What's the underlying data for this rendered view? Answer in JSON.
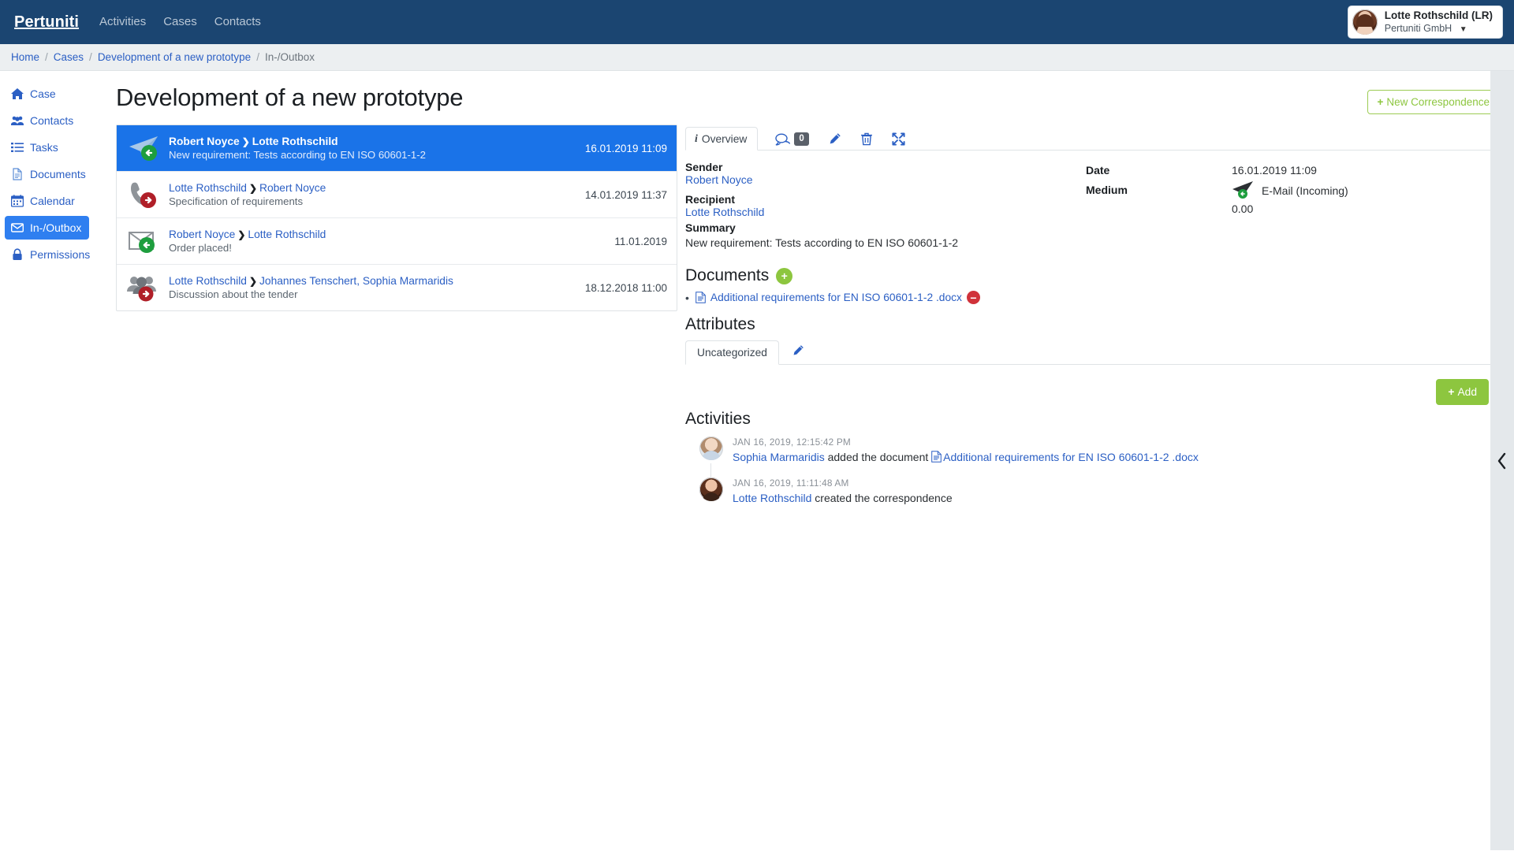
{
  "navbar": {
    "brand": "Pertuniti",
    "links": [
      "Activities",
      "Cases",
      "Contacts"
    ],
    "user": {
      "name": "Lotte Rothschild (LR)",
      "org": "Pertuniti GmbH"
    }
  },
  "breadcrumb": {
    "items": [
      {
        "label": "Home",
        "current": false
      },
      {
        "label": "Cases",
        "current": false
      },
      {
        "label": "Development of a new prototype",
        "current": false
      },
      {
        "label": "In-/Outbox",
        "current": true
      }
    ],
    "separator": "/"
  },
  "sidebar": {
    "items": [
      {
        "label": "Case",
        "icon": "home-icon",
        "active": false
      },
      {
        "label": "Contacts",
        "icon": "users-icon",
        "active": false
      },
      {
        "label": "Tasks",
        "icon": "list-icon",
        "active": false
      },
      {
        "label": "Documents",
        "icon": "file-icon",
        "active": false
      },
      {
        "label": "Calendar",
        "icon": "calendar-icon",
        "active": false
      },
      {
        "label": "In-/Outbox",
        "icon": "envelope-icon",
        "active": true
      },
      {
        "label": "Permissions",
        "icon": "lock-icon",
        "active": false
      }
    ]
  },
  "page": {
    "title": "Development of a new prototype",
    "new_correspondence_label": "New Correspondence",
    "plus": "+"
  },
  "correspondences": [
    {
      "from": "Robert Noyce",
      "to": "Lotte Rothschild",
      "arrow": "❯",
      "subject": "New requirement: Tests according to EN ISO 60601-1-2",
      "date": "16.01.2019 11:09",
      "icon": "paper-plane-incoming-icon",
      "selected": true
    },
    {
      "from": "Lotte Rothschild",
      "to": "Robert Noyce",
      "arrow": "❯",
      "subject": "Specification of requirements",
      "date": "14.01.2019 11:37",
      "icon": "phone-outgoing-icon",
      "selected": false
    },
    {
      "from": "Robert Noyce",
      "to": "Lotte Rothschild",
      "arrow": "❯",
      "subject": "Order placed!",
      "date": "11.01.2019",
      "icon": "letter-incoming-icon",
      "selected": false
    },
    {
      "from": "Lotte Rothschild",
      "to": "Johannes Tenschert, Sophia Marmaridis",
      "arrow": "❯",
      "subject": "Discussion about the tender",
      "date": "18.12.2018 11:00",
      "icon": "group-outgoing-icon",
      "selected": false
    }
  ],
  "detail": {
    "tab_overview": "Overview",
    "comment_count": "0",
    "sender_label": "Sender",
    "sender_value": "Robert Noyce",
    "recipient_label": "Recipient",
    "recipient_value": "Lotte Rothschild",
    "summary_label": "Summary",
    "summary_value": "New requirement: Tests according to EN ISO 60601-1-2",
    "date_label": "Date",
    "date_value": "16.01.2019 11:09",
    "medium_label": "Medium",
    "medium_value": "E-Mail (Incoming)",
    "amount_value": "0.00"
  },
  "documents": {
    "title": "Documents",
    "add_symbol": "+",
    "remove_symbol": "−",
    "bullet": "•",
    "items": [
      {
        "name": "Additional requirements for EN ISO 60601-1-2 .docx"
      }
    ]
  },
  "attributes": {
    "title": "Attributes",
    "tabs": [
      "Uncategorized"
    ],
    "add_label": "Add",
    "add_plus": "+"
  },
  "activities": {
    "title": "Activities",
    "items": [
      {
        "time": "JAN 16, 2019, 12:15:42 PM",
        "actor": "Sophia Marmaridis",
        "action": " added the document ",
        "target": "Additional requirements for EN ISO 60601-1-2 .docx",
        "avatar": "sophia-avatar"
      },
      {
        "time": "JAN 16, 2019, 11:11:48 AM",
        "actor": "Lotte Rothschild",
        "action": " created the correspondence",
        "target": "",
        "avatar": "lotte-avatar"
      }
    ]
  },
  "colors": {
    "navbar": "#1b4571",
    "accent_blue": "#2b5fc4",
    "selected_blue": "#1a73e8",
    "green": "#8dc63f",
    "red": "#d0323a",
    "incoming_green": "#1e9e3e",
    "outgoing_red": "#b01f28"
  }
}
